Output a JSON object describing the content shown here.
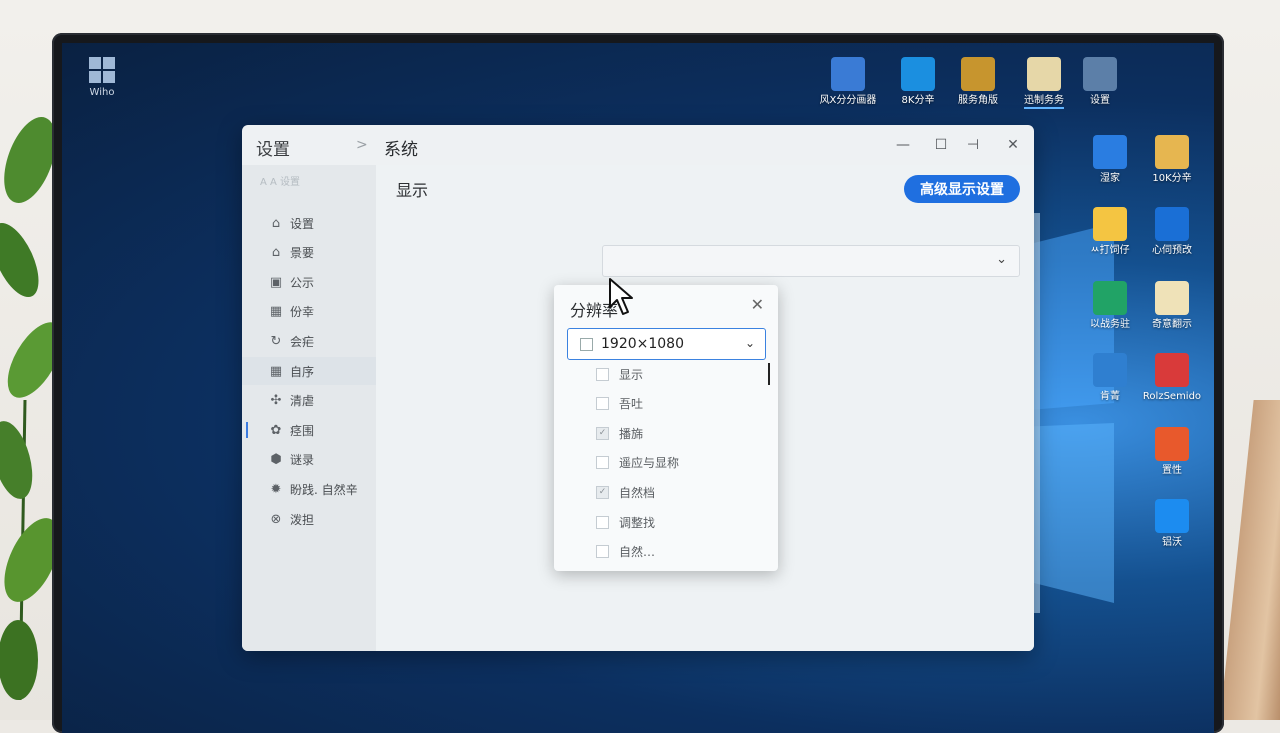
{
  "desktop": {
    "top_left_icon": {
      "label": "Wiho"
    },
    "top_icons": [
      {
        "label": "风X分分画器",
        "icon": "presentation-icon",
        "color": "#3a7bd5"
      },
      {
        "label": "8K分辛",
        "icon": "display-app-icon",
        "color": "#1b8fe0"
      },
      {
        "label": "服务角版",
        "icon": "chart-app-icon",
        "color": "#c7952e"
      },
      {
        "label": "迅制务务",
        "icon": "folder-app-icon",
        "color": "#e6d7a8"
      },
      {
        "label": "设置",
        "icon": "settings-app-icon",
        "color": "#5c7fa8"
      }
    ],
    "right_icons": [
      {
        "label": "湿家",
        "icon": "network-icon",
        "color": "#2a7de1"
      },
      {
        "label": "10K分辛",
        "icon": "folder-icon",
        "color": "#e6b650"
      },
      {
        "label": "ㅆ打饲仔",
        "icon": "document-icon",
        "color": "#f4c542"
      },
      {
        "label": "心伺预改",
        "icon": "shield-app-icon",
        "color": "#1a6fd6"
      },
      {
        "label": "以战务驻",
        "icon": "store-icon",
        "color": "#21a366"
      },
      {
        "label": "奇意翻示",
        "icon": "file-icon",
        "color": "#efe2b8"
      },
      {
        "label": "肯菁",
        "icon": "gear-icon",
        "color": "#2f7fd0"
      },
      {
        "label": "RolzSemido",
        "icon": "pdf-icon",
        "color": "#d93a3a"
      },
      {
        "label": "置性",
        "icon": "close-app-icon",
        "color": "#e8592c"
      },
      {
        "label": "铝沃",
        "icon": "cloud-app-icon",
        "color": "#1c8cf0"
      }
    ]
  },
  "window": {
    "app_title": "设置",
    "breadcrumb_sep": ">",
    "section_title": "系统",
    "controls": {
      "minimize": "—",
      "maximize": "☐",
      "snap": "⊣",
      "close": "✕"
    }
  },
  "sidebar": {
    "header": "A A 设置",
    "items": [
      {
        "label": "设置",
        "icon": "home-icon",
        "glyph": "⌂"
      },
      {
        "label": "景要",
        "icon": "house-icon",
        "glyph": "⌂"
      },
      {
        "label": "公示",
        "icon": "monitor-icon",
        "glyph": "▣"
      },
      {
        "label": "份幸",
        "icon": "grid-icon",
        "glyph": "▦"
      },
      {
        "label": "会疟",
        "icon": "sync-icon",
        "glyph": "↻"
      },
      {
        "label": "自序",
        "icon": "windows-icon",
        "glyph": "▦"
      },
      {
        "label": "清虐",
        "icon": "apps-icon",
        "glyph": "✣"
      },
      {
        "label": "痉围",
        "icon": "paint-icon",
        "glyph": "✿"
      },
      {
        "label": "谜录",
        "icon": "shield-icon",
        "glyph": "⬢"
      },
      {
        "label": "盼践. 自然辛",
        "icon": "gear-icon",
        "glyph": "✹"
      },
      {
        "label": "泼担",
        "icon": "update-icon",
        "glyph": "⊗"
      }
    ]
  },
  "content": {
    "display_title": "显示",
    "advanced_button": "高级显示设置",
    "main_select_chevron": "⌄"
  },
  "popup": {
    "title": "分辨率",
    "close": "✕",
    "selected_value": "1920×1080",
    "options": [
      {
        "label": "显示",
        "checked": false
      },
      {
        "label": "吾吐",
        "checked": false
      },
      {
        "label": "播旆",
        "checked": true
      },
      {
        "label": "遥应与显称",
        "checked": false
      },
      {
        "label": "自然档",
        "checked": true
      },
      {
        "label": "调整找",
        "checked": false
      },
      {
        "label": "自然…",
        "checked": false
      }
    ]
  }
}
